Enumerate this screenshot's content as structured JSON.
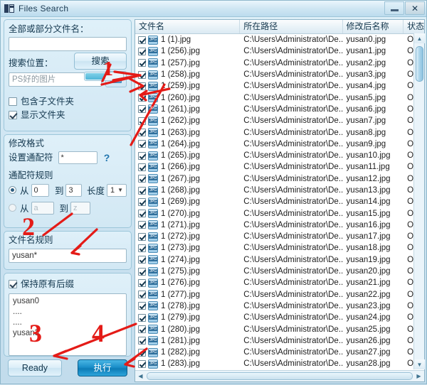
{
  "window": {
    "title": "Files Search",
    "icon": "app-icon",
    "minimize_label": "",
    "close_label": "✕"
  },
  "left_panel": {
    "filename_group": {
      "label": "全部或部分文件名：",
      "input_value": "",
      "input_placeholder": ""
    },
    "location_group": {
      "label": "搜索位置：",
      "input_value": "PS好的图片",
      "browse_icon": "folder-icon",
      "include_subfolders": {
        "label": "包含子文件夹",
        "checked": false
      },
      "show_folders": {
        "label": "显示文件夹",
        "checked": true
      },
      "search_button": "搜索"
    },
    "format_group": {
      "title": "修改格式",
      "wildcard_label": "设置通配符",
      "wildcard_value": "*",
      "help_icon": "question-icon"
    },
    "wildcard_rules": {
      "title": "通配符规则",
      "rule1": {
        "selected": true,
        "from_label": "从",
        "from_value": "0",
        "to_label": "到",
        "to_value": "3",
        "length_label": "长度",
        "length_value": "1"
      },
      "rule2": {
        "selected": false,
        "from_label": "从",
        "from_value": "a",
        "to_label": "到",
        "to_value": "z"
      }
    },
    "filename_rule": {
      "title": "文件名规则",
      "value": "yusan*"
    },
    "keep_suffix": {
      "label": "保持原有后缀",
      "checked": true
    },
    "preview_lines": [
      "yusan0",
      "....",
      "....",
      "yusan3"
    ],
    "buttons": {
      "ready": "Ready",
      "execute": "执行"
    }
  },
  "list": {
    "columns": [
      "文件名",
      "所在路径",
      "修改后名称",
      "状态"
    ],
    "rows": [
      {
        "checked": true,
        "name": "1 (1).jpg",
        "path": "C:\\Users\\Administrator\\De...",
        "newname": "yusan0.jpg",
        "status": "OK"
      },
      {
        "checked": true,
        "name": "1 (256).jpg",
        "path": "C:\\Users\\Administrator\\De...",
        "newname": "yusan1.jpg",
        "status": "OK"
      },
      {
        "checked": true,
        "name": "1 (257).jpg",
        "path": "C:\\Users\\Administrator\\De...",
        "newname": "yusan2.jpg",
        "status": "OK"
      },
      {
        "checked": true,
        "name": "1 (258).jpg",
        "path": "C:\\Users\\Administrator\\De...",
        "newname": "yusan3.jpg",
        "status": "OK"
      },
      {
        "checked": true,
        "name": "1 (259).jpg",
        "path": "C:\\Users\\Administrator\\De...",
        "newname": "yusan4.jpg",
        "status": "OK"
      },
      {
        "checked": true,
        "name": "1 (260).jpg",
        "path": "C:\\Users\\Administrator\\De...",
        "newname": "yusan5.jpg",
        "status": "OK"
      },
      {
        "checked": true,
        "name": "1 (261).jpg",
        "path": "C:\\Users\\Administrator\\De...",
        "newname": "yusan6.jpg",
        "status": "OK"
      },
      {
        "checked": true,
        "name": "1 (262).jpg",
        "path": "C:\\Users\\Administrator\\De...",
        "newname": "yusan7.jpg",
        "status": "OK"
      },
      {
        "checked": true,
        "name": "1 (263).jpg",
        "path": "C:\\Users\\Administrator\\De...",
        "newname": "yusan8.jpg",
        "status": "OK"
      },
      {
        "checked": true,
        "name": "1 (264).jpg",
        "path": "C:\\Users\\Administrator\\De...",
        "newname": "yusan9.jpg",
        "status": "OK"
      },
      {
        "checked": true,
        "name": "1 (265).jpg",
        "path": "C:\\Users\\Administrator\\De...",
        "newname": "yusan10.jpg",
        "status": "OK"
      },
      {
        "checked": true,
        "name": "1 (266).jpg",
        "path": "C:\\Users\\Administrator\\De...",
        "newname": "yusan11.jpg",
        "status": "OK"
      },
      {
        "checked": true,
        "name": "1 (267).jpg",
        "path": "C:\\Users\\Administrator\\De...",
        "newname": "yusan12.jpg",
        "status": "OK"
      },
      {
        "checked": true,
        "name": "1 (268).jpg",
        "path": "C:\\Users\\Administrator\\De...",
        "newname": "yusan13.jpg",
        "status": "OK"
      },
      {
        "checked": true,
        "name": "1 (269).jpg",
        "path": "C:\\Users\\Administrator\\De...",
        "newname": "yusan14.jpg",
        "status": "OK"
      },
      {
        "checked": true,
        "name": "1 (270).jpg",
        "path": "C:\\Users\\Administrator\\De...",
        "newname": "yusan15.jpg",
        "status": "OK"
      },
      {
        "checked": true,
        "name": "1 (271).jpg",
        "path": "C:\\Users\\Administrator\\De...",
        "newname": "yusan16.jpg",
        "status": "OK"
      },
      {
        "checked": true,
        "name": "1 (272).jpg",
        "path": "C:\\Users\\Administrator\\De...",
        "newname": "yusan17.jpg",
        "status": "OK"
      },
      {
        "checked": true,
        "name": "1 (273).jpg",
        "path": "C:\\Users\\Administrator\\De...",
        "newname": "yusan18.jpg",
        "status": "OK"
      },
      {
        "checked": true,
        "name": "1 (274).jpg",
        "path": "C:\\Users\\Administrator\\De...",
        "newname": "yusan19.jpg",
        "status": "OK"
      },
      {
        "checked": true,
        "name": "1 (275).jpg",
        "path": "C:\\Users\\Administrator\\De...",
        "newname": "yusan20.jpg",
        "status": "OK"
      },
      {
        "checked": true,
        "name": "1 (276).jpg",
        "path": "C:\\Users\\Administrator\\De...",
        "newname": "yusan21.jpg",
        "status": "OK"
      },
      {
        "checked": true,
        "name": "1 (277).jpg",
        "path": "C:\\Users\\Administrator\\De...",
        "newname": "yusan22.jpg",
        "status": "OK"
      },
      {
        "checked": true,
        "name": "1 (278).jpg",
        "path": "C:\\Users\\Administrator\\De...",
        "newname": "yusan23.jpg",
        "status": "OK"
      },
      {
        "checked": true,
        "name": "1 (279).jpg",
        "path": "C:\\Users\\Administrator\\De...",
        "newname": "yusan24.jpg",
        "status": "OK"
      },
      {
        "checked": true,
        "name": "1 (280).jpg",
        "path": "C:\\Users\\Administrator\\De...",
        "newname": "yusan25.jpg",
        "status": "OK"
      },
      {
        "checked": true,
        "name": "1 (281).jpg",
        "path": "C:\\Users\\Administrator\\De...",
        "newname": "yusan26.jpg",
        "status": "OK"
      },
      {
        "checked": true,
        "name": "1 (282).jpg",
        "path": "C:\\Users\\Administrator\\De...",
        "newname": "yusan27.jpg",
        "status": "OK"
      },
      {
        "checked": true,
        "name": "1 (283).jpg",
        "path": "C:\\Users\\Administrator\\De...",
        "newname": "yusan28.jpg",
        "status": "OK"
      }
    ]
  },
  "annotations": {
    "color": "#e41b17",
    "numbers": [
      "1",
      "2",
      "3",
      "4"
    ]
  }
}
